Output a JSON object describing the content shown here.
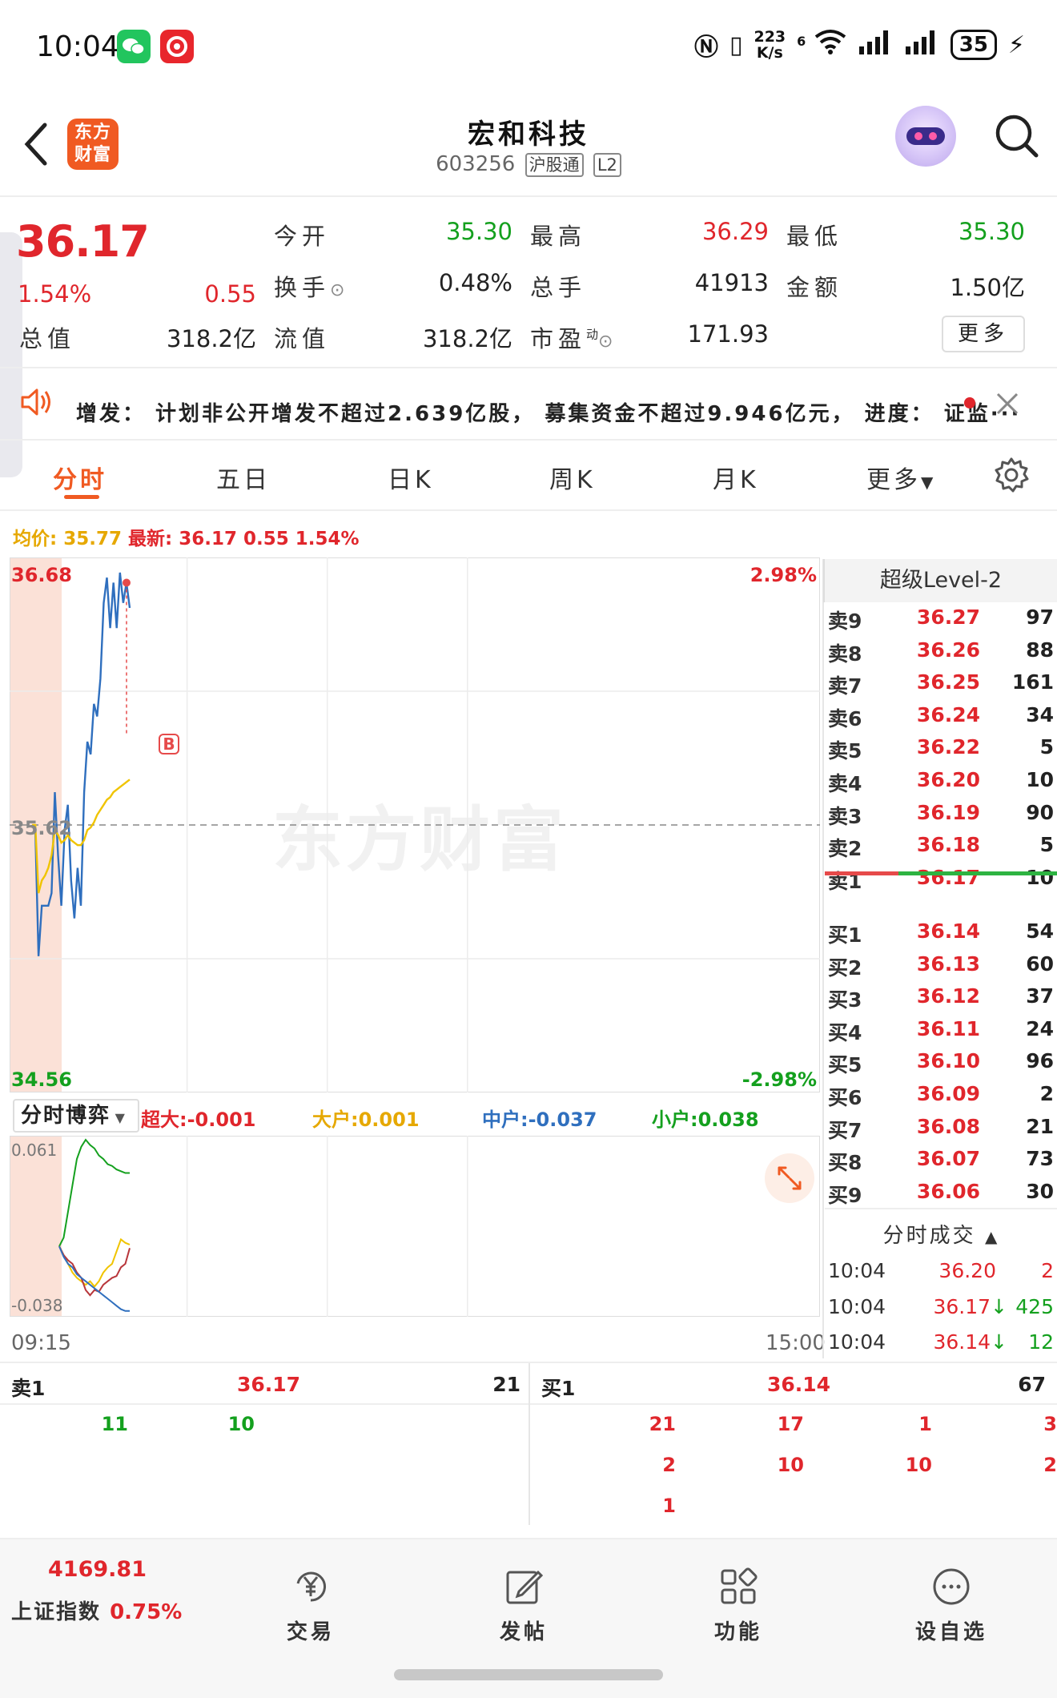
{
  "status_bar": {
    "time": "10:04",
    "net_speed_top": "223",
    "net_speed_bottom": "K/s",
    "signal_label": "6",
    "battery": "35"
  },
  "header": {
    "logo_line1": "东方",
    "logo_line2": "财富",
    "stock_name": "宏和科技",
    "stock_code": "603256",
    "tag_connect": "沪股通",
    "tag_level": "L2"
  },
  "quote": {
    "price": "36.17",
    "change_pct": "1.54%",
    "change": "0.55",
    "open_label": "今开",
    "open": "35.30",
    "high_label": "最高",
    "high": "36.29",
    "low_label": "最低",
    "low": "35.30",
    "turnover_label": "换手",
    "turnover": "0.48%",
    "volume_label": "总手",
    "volume": "41913",
    "amount_label": "金额",
    "amount": "1.50亿",
    "mktcap_label": "总值",
    "mktcap": "318.2亿",
    "float_label": "流值",
    "float": "318.2亿",
    "pe_label": "市盈",
    "pe_sup": "动",
    "pe": "171.93",
    "more_label": "更多"
  },
  "notice": {
    "text": "增发：  计划非公开增发不超过2.639亿股，  募集资金不超过9.946亿元，  进度：  证监···"
  },
  "tabs": [
    "分时",
    "五日",
    "日K",
    "周K",
    "月K",
    "更多"
  ],
  "chart_header": {
    "avg_label": "均价:",
    "avg": "35.77",
    "latest_label": "最新:",
    "latest": "36.17",
    "latest_change": "0.55",
    "latest_pct": "1.54%"
  },
  "chart_data": {
    "type": "line",
    "y_top": "36.68",
    "y_mid": "35.62",
    "y_bottom": "34.56",
    "pct_top": "2.98%",
    "pct_bottom": "-2.98%",
    "ylim": [
      34.56,
      36.68
    ],
    "prev_close": 35.62,
    "x_start": "09:15",
    "x_end": "15:00",
    "watermark": "东方财富",
    "marker": "B",
    "series": [
      {
        "color": "#2f6fbe",
        "values": [
          35.62,
          35.6,
          35.1,
          35.3,
          35.3,
          35.3,
          35.35,
          35.75,
          35.5,
          35.3,
          35.6,
          35.7,
          35.4,
          35.25,
          35.45,
          35.3,
          35.75,
          35.95,
          35.9,
          36.1,
          36.05,
          36.2,
          36.5,
          36.6,
          36.4,
          36.58,
          36.4,
          36.62,
          36.5,
          36.58,
          36.48
        ]
      },
      {
        "color": "#f0c400",
        "values": [
          35.62,
          35.62,
          35.35,
          35.4,
          35.42,
          35.45,
          35.5,
          35.6,
          35.58,
          35.55,
          35.56,
          35.58,
          35.56,
          35.55,
          35.54,
          35.54,
          35.56,
          35.6,
          35.61,
          35.63,
          35.66,
          35.68,
          35.7,
          35.72,
          35.73,
          35.75,
          35.76,
          35.77,
          35.78,
          35.79,
          35.8
        ]
      }
    ]
  },
  "indicator": {
    "name": "分时博弈",
    "super_label": "超大",
    "super": ":-0.001",
    "big_label": "大户",
    "big": ":0.001",
    "mid_label": "中户",
    "mid": ":-0.037",
    "small_label": "小户",
    "small": ":0.038",
    "top": "0.061",
    "bottom": "-0.038"
  },
  "indicator_data": {
    "type": "line",
    "ylim": [
      -0.038,
      0.061
    ],
    "series": [
      {
        "color": "#14a01e",
        "values": [
          0.0,
          0.005,
          0.02,
          0.035,
          0.05,
          0.057,
          0.061,
          0.058,
          0.056,
          0.052,
          0.05,
          0.047,
          0.046,
          0.044,
          0.043,
          0.042,
          0.042
        ]
      },
      {
        "color": "#f0c400",
        "values": [
          0.0,
          -0.005,
          -0.01,
          -0.015,
          -0.018,
          -0.02,
          -0.022,
          -0.02,
          -0.023,
          -0.02,
          -0.015,
          -0.012,
          -0.01,
          -0.003,
          0.004,
          0.002,
          0.001
        ]
      },
      {
        "color": "#b8363b",
        "values": [
          0.0,
          -0.005,
          -0.008,
          -0.01,
          -0.015,
          -0.018,
          -0.025,
          -0.028,
          -0.025,
          -0.026,
          -0.022,
          -0.02,
          -0.018,
          -0.017,
          -0.012,
          -0.01,
          -0.001
        ]
      },
      {
        "color": "#2f6fbe",
        "values": [
          0.0,
          -0.006,
          -0.01,
          -0.012,
          -0.016,
          -0.018,
          -0.02,
          -0.022,
          -0.024,
          -0.026,
          -0.028,
          -0.03,
          -0.032,
          -0.034,
          -0.036,
          -0.037,
          -0.037
        ]
      }
    ]
  },
  "orderbook": {
    "title": "超级Level-2",
    "asks": [
      {
        "label": "卖9",
        "price": "36.27",
        "vol": "97"
      },
      {
        "label": "卖8",
        "price": "36.26",
        "vol": "88"
      },
      {
        "label": "卖7",
        "price": "36.25",
        "vol": "161"
      },
      {
        "label": "卖6",
        "price": "36.24",
        "vol": "34"
      },
      {
        "label": "卖5",
        "price": "36.22",
        "vol": "5"
      },
      {
        "label": "卖4",
        "price": "36.20",
        "vol": "10"
      },
      {
        "label": "卖3",
        "price": "36.19",
        "vol": "90"
      },
      {
        "label": "卖2",
        "price": "36.18",
        "vol": "5"
      },
      {
        "label": "卖1",
        "price": "36.17",
        "vol": "10"
      }
    ],
    "bids": [
      {
        "label": "买1",
        "price": "36.14",
        "vol": "54"
      },
      {
        "label": "买2",
        "price": "36.13",
        "vol": "60"
      },
      {
        "label": "买3",
        "price": "36.12",
        "vol": "37"
      },
      {
        "label": "买4",
        "price": "36.11",
        "vol": "24"
      },
      {
        "label": "买5",
        "price": "36.10",
        "vol": "96"
      },
      {
        "label": "买6",
        "price": "36.09",
        "vol": "2"
      },
      {
        "label": "买7",
        "price": "36.08",
        "vol": "21"
      },
      {
        "label": "买8",
        "price": "36.07",
        "vol": "73"
      },
      {
        "label": "买9",
        "price": "36.06",
        "vol": "30"
      }
    ],
    "ticks_title": "分时成交",
    "ticks": [
      {
        "time": "10:04",
        "price": "36.20",
        "vol": "2"
      },
      {
        "time": "10:04",
        "price": "36.17",
        "vol": "425"
      },
      {
        "time": "10:04",
        "price": "36.14",
        "vol": "12"
      }
    ]
  },
  "queue": {
    "sell_label": "卖1",
    "sell_price": "36.17",
    "sell_total": "21",
    "sell_orders": [
      "11",
      "10"
    ],
    "buy_label": "买1",
    "buy_price": "36.14",
    "buy_total": "67",
    "buy_orders": [
      "21",
      "17",
      "1",
      "3",
      "2",
      "10",
      "10",
      "2",
      "1"
    ]
  },
  "nav": {
    "index_value": "4169.81",
    "index_label": "上证指数",
    "index_pct": "0.75%",
    "items": [
      "交易",
      "发帖",
      "功能",
      "设自选"
    ]
  }
}
